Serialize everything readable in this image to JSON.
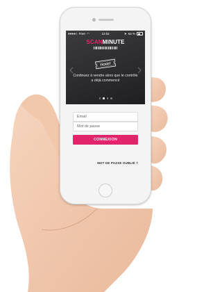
{
  "status_bar": {
    "carrier": "Free",
    "time": "12:02",
    "battery": "64 %",
    "battery_level": 0.64
  },
  "app": {
    "logo_part1": "SCAN",
    "logo_part2": "MINUTE",
    "ticket_label": "TICKET",
    "caption": "Continuez à vendre alors que le contrôle a déjà commencé",
    "carousel_page_index": 1,
    "carousel_page_count": 4
  },
  "form": {
    "email_placeholder": "Email",
    "password_placeholder": "Mot de passe",
    "login_label": "CONNEXION",
    "forgot_label": "MOT DE PASSE OUBLIÉ ?"
  },
  "colors": {
    "accent": "#e2246b",
    "hero_bg": "#2e2e30",
    "form_bg": "#f4f4f4"
  }
}
